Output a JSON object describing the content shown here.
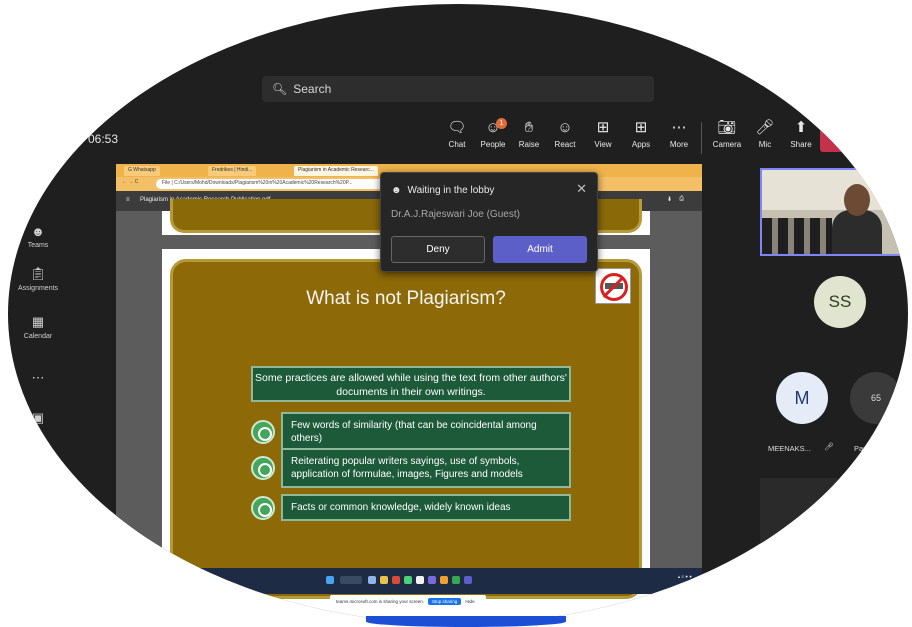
{
  "search": {
    "placeholder": "Search"
  },
  "meeting": {
    "timer": "06:53"
  },
  "toolbar": [
    {
      "label": "Chat",
      "icon": "chat-icon"
    },
    {
      "label": "People",
      "icon": "people-icon",
      "badge": "1"
    },
    {
      "label": "Raise",
      "icon": "hand-icon"
    },
    {
      "label": "React",
      "icon": "smile-icon"
    },
    {
      "label": "View",
      "icon": "grid-icon"
    },
    {
      "label": "Apps",
      "icon": "plus-icon"
    },
    {
      "label": "More",
      "icon": "more-icon"
    },
    {
      "label": "Camera",
      "icon": "camera-off-icon"
    },
    {
      "label": "Mic",
      "icon": "mic-off-icon"
    },
    {
      "label": "Share",
      "icon": "share-icon"
    }
  ],
  "rail": [
    {
      "label": "Teams",
      "icon": "teams-icon"
    },
    {
      "label": "Assignments",
      "icon": "assignments-icon"
    },
    {
      "label": "Calendar",
      "icon": "calendar-icon"
    }
  ],
  "browser": {
    "tabs": [
      "G Whatsapp",
      "Fredrikes | Hindi...",
      "Plagiarism in Academic Researc..."
    ],
    "url": "File | C:/Users/Mohd/Downloads/Plagiarism%20in%20Academic%20Research%20P..."
  },
  "pdf": {
    "filename": "Plagiarism in Academic Research Publication.pdf"
  },
  "slide": {
    "title": "What is not Plagiarism?",
    "intro": "Some practices are allowed while using the text from other authors' documents in their own writings.",
    "bullets": [
      "Few words of similarity (that can be coincidental among others)",
      "Reiterating popular writers sayings, use of symbols, application of formulae, images, Figures and models",
      "Facts or common knowledge, widely known ideas"
    ]
  },
  "sharing": {
    "message": "teams.microsoft.com is sharing your screen.",
    "stop": "Stop sharing",
    "hide": "Hide"
  },
  "lobby": {
    "title": "Waiting in the lobby",
    "name": "Dr.A.J.Rajeswari Joe (Guest)",
    "deny": "Deny",
    "admit": "Admit"
  },
  "participants": {
    "ss_initials": "SS",
    "m_initial": "M",
    "m_name": "MEENAKS...",
    "count": "65",
    "count_label": "Participants"
  },
  "colors": {
    "accent": "#5b5fc7",
    "slide_bg": "#8d6a07",
    "leave": "#c4314b"
  }
}
